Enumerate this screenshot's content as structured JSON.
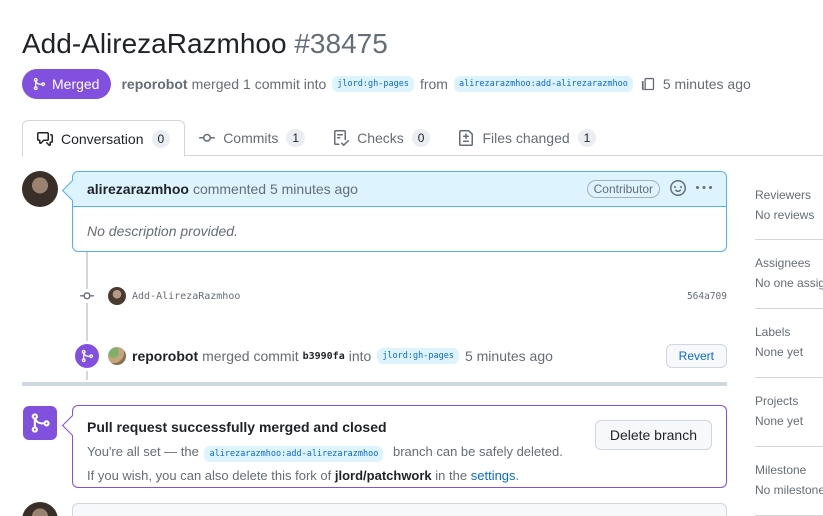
{
  "pr": {
    "title": "Add-AlirezaRazmhoo",
    "number": "#38475",
    "state": "Merged",
    "author": "reporobot",
    "merged_text": "merged",
    "commit_count_text": "1 commit into",
    "base_branch": "jlord:gh-pages",
    "from_text": "from",
    "head_branch": "alirezarazmhoo:add-alirezarazmhoo",
    "time": "5 minutes ago"
  },
  "tabs": [
    {
      "label": "Conversation",
      "count": "0",
      "icon": "comment-discussion-icon"
    },
    {
      "label": "Commits",
      "count": "1",
      "icon": "git-commit-icon"
    },
    {
      "label": "Checks",
      "count": "0",
      "icon": "checklist-icon"
    },
    {
      "label": "Files changed",
      "count": "1",
      "icon": "file-diff-icon"
    }
  ],
  "comment": {
    "author": "alirezarazmhoo",
    "action": "commented 5 minutes ago",
    "role": "Contributor",
    "body": "No description provided."
  },
  "commit": {
    "message": "Add-AlirezaRazmhoo",
    "sha": "564a709"
  },
  "merge_event": {
    "actor": "reporobot",
    "text1": "merged commit",
    "sha": "b3990fa",
    "text2": "into",
    "branch": "jlord:gh-pages",
    "time": "5 minutes ago",
    "revert_label": "Revert"
  },
  "merged_box": {
    "title": "Pull request successfully merged and closed",
    "line1_pre": "You're all set — the",
    "line1_branch": "alirezarazmhoo:add-alirezarazmhoo",
    "line1_post": "branch can be safely deleted.",
    "line2_pre": "If you wish, you can also delete this fork of",
    "line2_repo": "jlord/patchwork",
    "line2_mid": "in the",
    "line2_link": "settings",
    "line2_end": ".",
    "delete_label": "Delete branch"
  },
  "sidebar": [
    {
      "heading": "Reviewers",
      "value": "No reviews"
    },
    {
      "heading": "Assignees",
      "value": "No one assigned"
    },
    {
      "heading": "Labels",
      "value": "None yet"
    },
    {
      "heading": "Projects",
      "value": "None yet"
    },
    {
      "heading": "Milestone",
      "value": "No milestone"
    }
  ],
  "colors": {
    "merged": "#8250df",
    "link": "#0969da",
    "comment_border": "#54aeff",
    "comment_header": "#ddf4ff"
  }
}
